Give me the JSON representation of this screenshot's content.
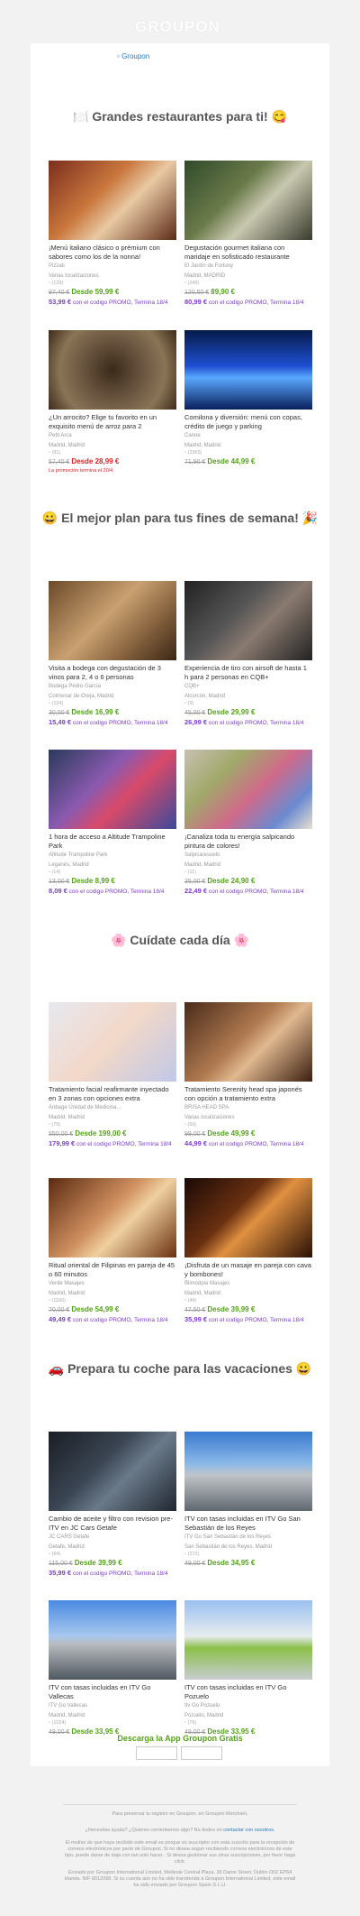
{
  "header": {
    "logo_alt": "",
    "brand": "GROUPON",
    "top_logo_alt": "Groupon"
  },
  "sections": [
    {
      "title": "🍽️ Grandes restaurantes para ti! 😋",
      "deals": [
        {
          "title": "¡Menú italiano clásico o prémium con sabores como los de la nonna!",
          "merchant": "Pizzati",
          "location": "Varias localizaciones",
          "ratings": "(128)",
          "old": "97,40 €",
          "price": "Desde 59,99 €",
          "promo_price": "53,99 €",
          "promo_text": "con el codigo PROMO, Termina 18/4"
        },
        {
          "title": "Degustación gourmet italiana con maridaje en sofisticado restaurante",
          "merchant": "El Jardín de Fortuny",
          "location": "Madrid, MADRID",
          "ratings": "(249)",
          "old": "120,50 €",
          "price": "89,90 €",
          "promo_price": "80,99 €",
          "promo_text": "con el codigo PROMO, Termina 18/4"
        },
        {
          "title": "¿Un arrocito? Elige tu favorito en un exquisito menú de arroz para 2",
          "merchant": "Petit Arca",
          "location": "Madrid, Madrid",
          "ratings": "(81)",
          "old": "57,40 €",
          "price": "Desde 28,99 €",
          "note": "La promoción termina el 20/4"
        },
        {
          "title": "Comilona y diversión: menú con copas, crédito de juego y parking",
          "merchant": "Canoe",
          "location": "Madrid, Madrid",
          "ratings": "(2365)",
          "old": "71,90 €",
          "price": "Desde 44,99 €"
        }
      ]
    },
    {
      "title": "😀 El mejor plan para tus fines de semana! 🎉",
      "deals": [
        {
          "title": "Visita a bodega con degustación de 3 vinos para 2, 4 o 6 personas",
          "merchant": "Bodega Pedro García",
          "location": "Colmenar de Oreja, Madrid",
          "ratings": "(124)",
          "old": "30,00 €",
          "price": "Desde 16,99 €",
          "promo_price": "15,49 €",
          "promo_text": "con el codigo PROMO, Termina 18/4"
        },
        {
          "title": "Experiencia de tiro con airsoft de hasta 1 h para 2 personas en CQB+",
          "merchant": "CQB+",
          "location": "Alcorcón, Madrid",
          "ratings": "(9)",
          "old": "45,00 €",
          "price": "Desde 29,99 €",
          "promo_price": "26,99 €",
          "promo_text": "con el codigo PROMO, Termina 18/4"
        },
        {
          "title": "1 hora de acceso a Altitude Trampoline Park",
          "merchant": "Altitude Trampoline Park",
          "location": "Leganés, Madrid",
          "ratings": "(14)",
          "old": "13,00 €",
          "price": "Desde 8,99 €",
          "promo_price": "8,09 €",
          "promo_text": "con el codigo PROMO, Termina 18/4"
        },
        {
          "title": "¡Canaliza toda tu energía salpicando pintura de colores!",
          "merchant": "Salpicaresuelo",
          "location": "Madrid, Madrid",
          "ratings": "(11)",
          "old": "35,00 €",
          "price": "Desde 24,90 €",
          "promo_price": "22,49 €",
          "promo_text": "con el codigo PROMO, Termina 18/4"
        }
      ]
    },
    {
      "title": "🌸 Cuídate cada día 🌸",
      "deals": [
        {
          "title": "Tratamiento facial reafirmante inyectado en 3 zonas con opciones extra",
          "merchant": "Anbage Unidad de Medicina...",
          "location": "Madrid, Madrid",
          "ratings": "(79)",
          "old": "550,00 €",
          "price": "Desde 199,00 €",
          "promo_price": "179,99 €",
          "promo_text": "con el codigo PROMO, Termina 18/4"
        },
        {
          "title": "Tratamiento Serenity head spa japonés con opción a tratamiento extra",
          "merchant": "BRISA HEAD SPA",
          "location": "Varias localizaciones",
          "ratings": "(59)",
          "old": "99,00 €",
          "price": "Desde 49,99 €",
          "promo_price": "44,99 €",
          "promo_text": "con el codigo PROMO, Termina 18/4"
        },
        {
          "title": "Ritual oriental de Filipinas en pareja de 45 o 60 minutos",
          "merchant": "Verde Masajes",
          "location": "Madrid, Madrid",
          "ratings": "(1166)",
          "old": "70,00 €",
          "price": "Desde 54,99 €",
          "promo_price": "49,49 €",
          "promo_text": "con el codigo PROMO, Termina 18/4"
        },
        {
          "title": "¡Disfruta de un masaje en pareja con cava y bombones!",
          "merchant": "Blimodpia Masajes",
          "location": "Madrid, Madrid",
          "ratings": "(44)",
          "old": "47,50 €",
          "price": "Desde 39,99 €",
          "promo_price": "35,99 €",
          "promo_text": "con el codigo PROMO, Termina 18/4"
        }
      ]
    },
    {
      "title": "🚗 Prepara tu coche para las vacaciones 😀",
      "deals": [
        {
          "title": "Cambio de aceite y filtro con revision pre-ITV en JC Cars Getafe",
          "merchant": "JC CARS Getafe",
          "location": "Getafe, Madrid",
          "ratings": "(64)",
          "old": "115,00 €",
          "price": "Desde 39,99 €",
          "promo_price": "35,99 €",
          "promo_text": "con el codigo PROMO, Termina 18/4"
        },
        {
          "title": "ITV con tasas incluidas en ITV Go San Sebastián de los Reyes",
          "merchant": "ITV Go San Sebastián de los Reyes",
          "location": "San Sebastián de los Reyes, Madrid",
          "ratings": "(272)",
          "old": "49,00 €",
          "price": "Desde 34,95 €"
        },
        {
          "title": "ITV con tasas incluidas en ITV Go Vallecas",
          "merchant": "ITV Go Vallecas",
          "location": "Madrid, Madrid",
          "ratings": "(1024)",
          "old": "49,00 €",
          "price": "Desde 33,95 €"
        },
        {
          "title": "ITV con tasas incluidas en ITV Go Pozuelo",
          "merchant": "Itv Go Pozuelo",
          "location": "Pozuelo, Madrid",
          "ratings": "(76)",
          "old": "49,00 €",
          "price": "Desde 33,95 €"
        }
      ]
    }
  ],
  "app": {
    "cta": "Descarga la App Groupon Gratis"
  },
  "footer": {
    "manage": "Para preservar tu registro en Groupon, en Groupon Merchant.",
    "help_prefix": "¿Necesitas ayuda? ¿Quieres comentarnos algo? No dudes en",
    "help_link": "contactar con nosotros",
    "legal": "El motivo de que haya recibido este email es porque es suscriptor con esta suscrito para la recepción de correos electrónicos por parte de Groupon. Si no desea seguir recibiendo correos electrónicos de este tipo, puede darse de baja con tan solo hacer . Si desea gestionar sus otras suscripciones, por favor haga click.",
    "company": "Enviado por Groupon International Limited, Wellesle Central Plaza, 30 Dame Street, Dublin D02 EP64 Irlanda. NIF:0012098. Si su cuenta aún no ha sido transferida a Groupon International Limited, este email ha sido enviado por Groupon Spain S.L.U."
  },
  "colors": {
    "green": "#53a318",
    "purple": "#7a3ec9",
    "red": "#d9252a"
  }
}
